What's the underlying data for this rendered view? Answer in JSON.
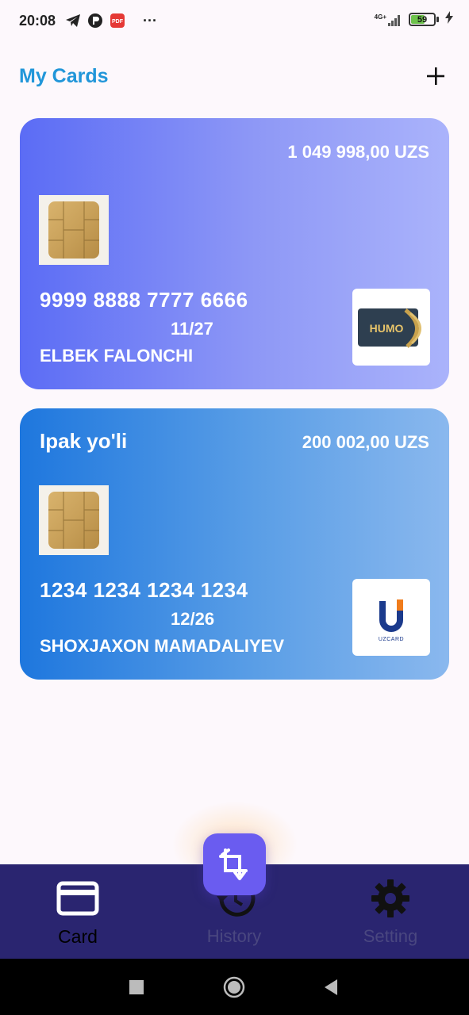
{
  "status_bar": {
    "time": "20:08",
    "network": "4G+",
    "battery": "59",
    "overflow": "···"
  },
  "header": {
    "title": "My Cards",
    "add_icon": "plus-icon"
  },
  "cards": [
    {
      "bank": "",
      "balance": "1 049 998,00 UZS",
      "number": "9999 8888 7777 6666",
      "expiry": "11/27",
      "holder": "ELBEK FALONCHI",
      "brand": "HUMO",
      "colors": [
        "#5b6cf5",
        "#aab3fb"
      ]
    },
    {
      "bank": "Ipak yo'li",
      "balance": "200 002,00 UZS",
      "number": "1234 1234 1234 1234",
      "expiry": "12/26",
      "holder": "SHOXJAXON MAMADALIYEV",
      "brand": "UZCARD",
      "colors": [
        "#1e77de",
        "#8ab8ee"
      ]
    }
  ],
  "bottom_nav": {
    "items": [
      {
        "label": "Card",
        "icon": "credit-card-icon",
        "active": true
      },
      {
        "label": "History",
        "icon": "history-icon",
        "active": false
      },
      {
        "label": "Setting",
        "icon": "gear-icon",
        "active": false
      }
    ],
    "fab_icon": "crop-transfer-icon"
  },
  "colors": {
    "title": "#2196d9",
    "nav_bg": "#2a2570",
    "fab": "#6a5cf0"
  }
}
